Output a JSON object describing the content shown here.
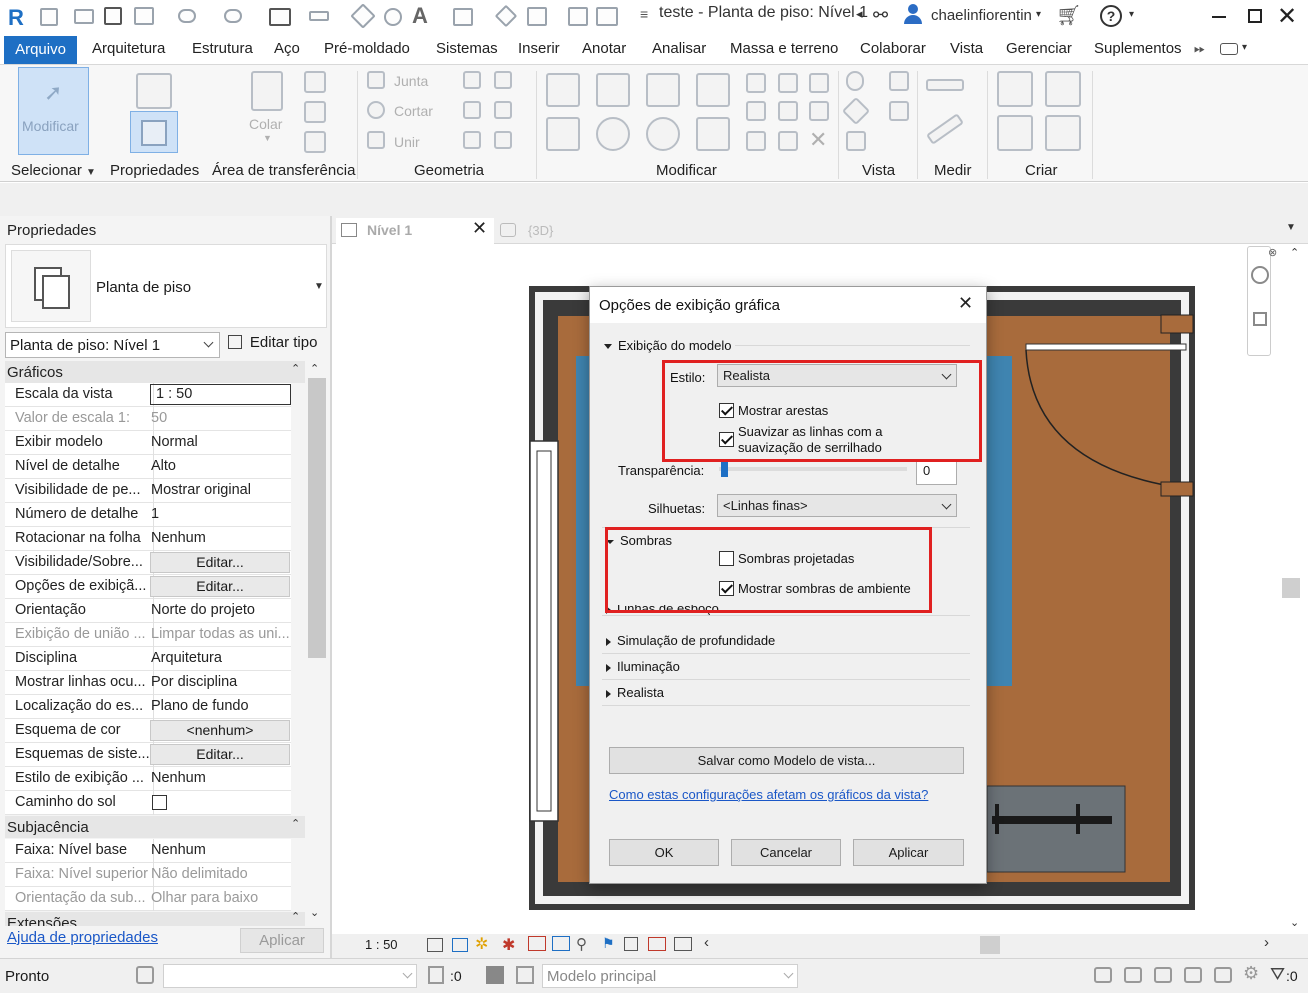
{
  "titlebar": {
    "title": "teste - Planta de piso: Nível 1",
    "user": "chaelinfiorentin"
  },
  "ribbon_tabs": [
    "Arquivo",
    "Arquitetura",
    "Estrutura",
    "Aço",
    "Pré-moldado",
    "Sistemas",
    "Inserir",
    "Anotar",
    "Analisar",
    "Massa e terreno",
    "Colaborar",
    "Vista",
    "Gerenciar",
    "Suplementos"
  ],
  "ribbon": {
    "modify_label": "Modificar",
    "colar_label": "Colar",
    "junta": "Junta",
    "cortar": "Cortar",
    "unir": "Unir",
    "panels": [
      "Selecionar",
      "Propriedades",
      "Área de transferência",
      "Geometria",
      "Modificar",
      "Vista",
      "Medir",
      "Criar"
    ]
  },
  "properties": {
    "title": "Propriedades",
    "type_name": "Planta de piso",
    "instance": "Planta de piso: Nível 1",
    "edit_type": "Editar tipo",
    "sections": {
      "graficos": "Gráficos",
      "subjacencia": "Subjacência",
      "extensoes": "Extensões"
    },
    "rows": [
      {
        "k": "Escala da vista",
        "v": "1 : 50"
      },
      {
        "k": "Valor de escala    1:",
        "v": "50"
      },
      {
        "k": "Exibir modelo",
        "v": "Normal"
      },
      {
        "k": "Nível de detalhe",
        "v": "Alto"
      },
      {
        "k": "Visibilidade de pe...",
        "v": "Mostrar original"
      },
      {
        "k": "Número de detalhe",
        "v": "1"
      },
      {
        "k": "Rotacionar na folha",
        "v": "Nenhum"
      },
      {
        "k": "Visibilidade/Sobre...",
        "v": "Editar..."
      },
      {
        "k": "Opções de exibiçã...",
        "v": "Editar..."
      },
      {
        "k": "Orientação",
        "v": "Norte do projeto"
      },
      {
        "k": "Exibição de união ...",
        "v": "Limpar todas as uni..."
      },
      {
        "k": "Disciplina",
        "v": "Arquitetura"
      },
      {
        "k": "Mostrar linhas ocu...",
        "v": "Por disciplina"
      },
      {
        "k": "Localização do es...",
        "v": "Plano de fundo"
      },
      {
        "k": "Esquema de cor",
        "v": "<nenhum>"
      },
      {
        "k": "Esquemas de siste...",
        "v": "Editar..."
      },
      {
        "k": "Estilo de exibição ...",
        "v": "Nenhum"
      },
      {
        "k": "Caminho do sol",
        "v": ""
      }
    ],
    "sub_rows": [
      {
        "k": "Faixa: Nível base",
        "v": "Nenhum"
      },
      {
        "k": "Faixa: Nível superior",
        "v": "Não delimitado"
      },
      {
        "k": "Orientação da sub...",
        "v": "Olhar para baixo"
      }
    ],
    "help_link": "Ajuda de propriedades",
    "apply": "Aplicar"
  },
  "view_tabs": [
    {
      "label": "Nível 1"
    },
    {
      "label": "{3D}"
    }
  ],
  "view_scale": "1 : 50",
  "dialog": {
    "title": "Opções de exibição gráfica",
    "model_display": "Exibição do modelo",
    "style_label": "Estilo:",
    "style_value": "Realista",
    "show_edges": "Mostrar arestas",
    "smooth_lines_1": "Suavizar as linhas com a",
    "smooth_lines_2": "suavização de serrilhado",
    "transparency_label": "Transparência:",
    "transparency_value": "0",
    "silhouettes_label": "Silhuetas:",
    "silhouettes_value": "<Linhas finas>",
    "shadows": "Sombras",
    "cast_shadows": "Sombras projetadas",
    "ambient_shadows": "Mostrar sombras de ambiente",
    "sketchy_lines": "Linhas de esboço",
    "depth_cueing": "Simulação de profundidade",
    "lighting": "Iluminação",
    "realistic": "Realista",
    "save_template": "Salvar como Modelo de vista...",
    "help_link": "Como estas configurações afetam os gráficos da vista?",
    "ok": "OK",
    "cancel": "Cancelar",
    "apply": "Aplicar"
  },
  "status": {
    "ready": "Pronto",
    "zero": ":0",
    "model": "Modelo principal"
  },
  "colors": {
    "accent": "#1e6fc4",
    "highlight": "#e02020",
    "floor": "#a86b3c",
    "wall": "#3a3a3a",
    "glass": "#3f84b0"
  }
}
